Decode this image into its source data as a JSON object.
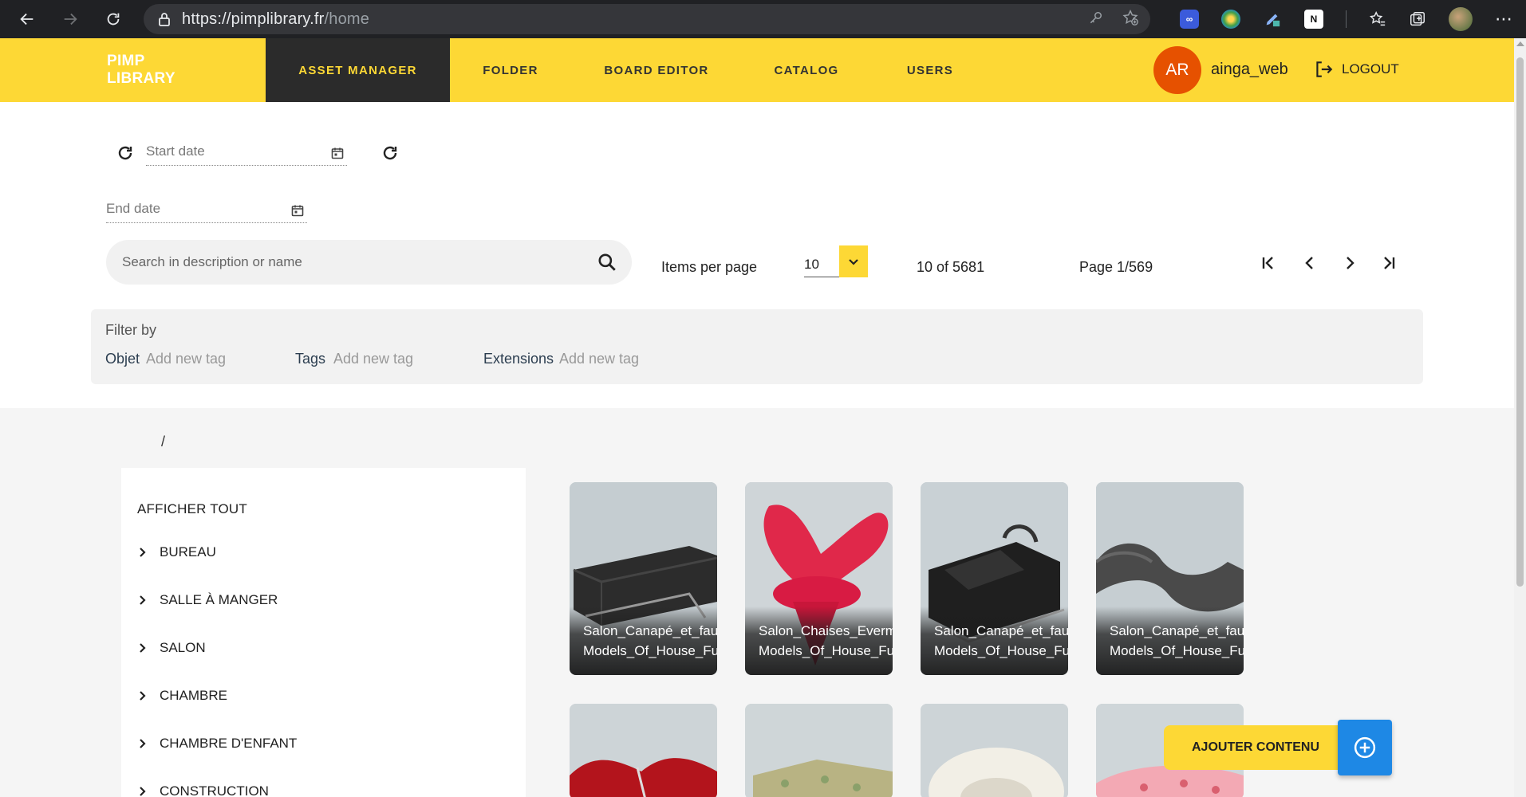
{
  "browser": {
    "url_host": "https://pimplibrary.fr",
    "url_path": "/home"
  },
  "app": {
    "logo_line1": "PIMP",
    "logo_line2": "LIBRARY",
    "nav": [
      {
        "label": "ASSET MANAGER",
        "active": true
      },
      {
        "label": "FOLDER",
        "active": false
      },
      {
        "label": "BOARD EDITOR",
        "active": false
      },
      {
        "label": "CATALOG",
        "active": false
      },
      {
        "label": "USERS",
        "active": false
      }
    ],
    "user_initials": "AR",
    "username": "ainga_web",
    "logout_label": "LOGOUT"
  },
  "filters": {
    "start_date_placeholder": "Start date",
    "end_date_placeholder": "End date",
    "search_placeholder": "Search in description or name",
    "items_per_page_label": "Items per page",
    "items_per_page_value": "10",
    "count_text": "10 of 5681",
    "page_text": "Page 1/569",
    "filter_by_label": "Filter by",
    "objet_label": "Objet",
    "tags_label": "Tags",
    "extensions_label": "Extensions",
    "add_tag_placeholder": "Add new tag"
  },
  "breadcrumb": "/",
  "sidebar": {
    "show_all": "AFFICHER TOUT",
    "items": [
      "BUREAU",
      "SALLE À MANGER",
      "SALON",
      "CHAMBRE",
      "CHAMBRE D'ENFANT",
      "CONSTRUCTION"
    ]
  },
  "cards": [
    {
      "line1": "Salon_Canapé_et_fauteuils",
      "line2": "Models_Of_House_Furniture"
    },
    {
      "line1": "Salon_Chaises_Evermotion",
      "line2": "Models_Of_House_Furniture"
    },
    {
      "line1": "Salon_Canapé_et_fauteuils",
      "line2": "Models_Of_House_Furniture"
    },
    {
      "line1": "Salon_Canapé_et_fauteuils",
      "line2": "Models_Of_House_Furniture"
    }
  ],
  "actions": {
    "add_content_label": "AJOUTER CONTENU"
  },
  "colors": {
    "brand_yellow": "#fdd835",
    "dark": "#2b2b2b",
    "avatar_orange": "#e65100",
    "fab_blue": "#1e88e5"
  }
}
